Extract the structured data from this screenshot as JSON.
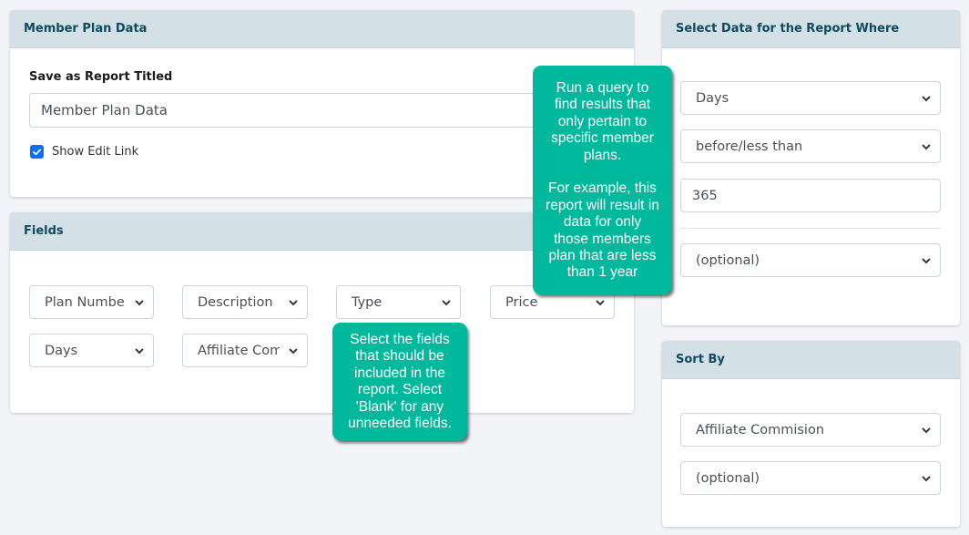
{
  "member_plan_card": {
    "title": "Member Plan Data",
    "report_title_label": "Save as Report Titled",
    "report_title_value": "Member Plan Data",
    "show_edit_link": {
      "label": "Show Edit Link",
      "checked": true
    }
  },
  "fields_card": {
    "title": "Fields",
    "fields": [
      {
        "value": "Plan Number"
      },
      {
        "value": "Description"
      },
      {
        "value": "Type"
      },
      {
        "value": "Price"
      },
      {
        "value": "Days"
      },
      {
        "value": "Affiliate Com"
      }
    ]
  },
  "filter_card": {
    "title": "Select Data for the Report Where",
    "field_select": "Days",
    "operator_select": "before/less than",
    "value_input": "365",
    "extra_select": "(optional)"
  },
  "sort_card": {
    "title": "Sort By",
    "primary_select": "Affiliate Commision",
    "secondary_select": "(optional)"
  },
  "tooltips": {
    "query_hint": "Run a query to\nfind results that\nonly pertain to\nspecific member\nplans.\n\nFor example, this\nreport will result in\ndata for only\nthose members\nplan that are less\nthan 1 year",
    "fields_hint": "Select the fields\nthat should be\nincluded in the\nreport. Select\n'Blank' for any\nunneeded fields."
  },
  "colors": {
    "header_bg": "#d3e0e5",
    "header_text": "#0e4b5c",
    "tooltip_bg": "#00b89c",
    "checkbox": "#0d6efd",
    "page_bg": "#f3f4f8"
  }
}
